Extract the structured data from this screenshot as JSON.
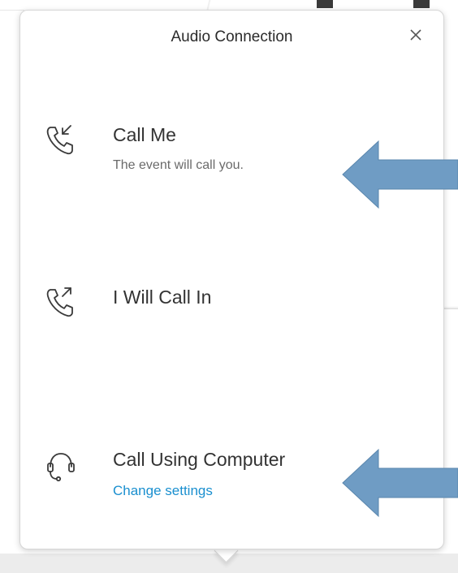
{
  "dialog": {
    "title": "Audio Connection",
    "close_icon": "close-icon"
  },
  "options": [
    {
      "label": "Call Me",
      "sub": "The event will call you.",
      "icon": "phone-incoming-icon"
    },
    {
      "label": "I Will Call In",
      "icon": "phone-outgoing-icon"
    },
    {
      "label": "Call Using Computer",
      "link": "Change settings",
      "icon": "headset-icon"
    }
  ],
  "colors": {
    "link": "#1a8fcf",
    "annotation_arrow": "#6f9cc4"
  }
}
